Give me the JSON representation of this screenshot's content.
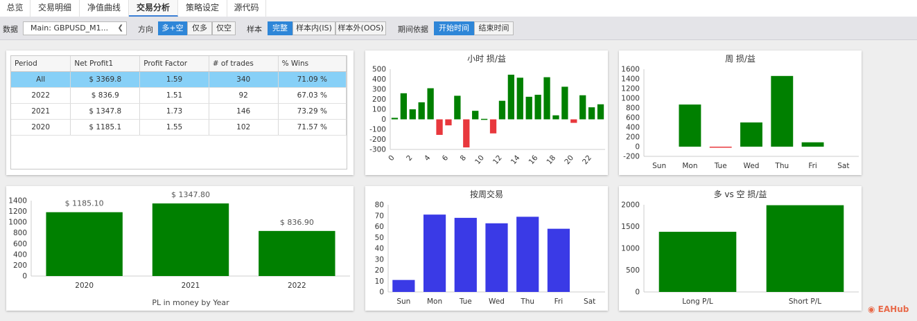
{
  "tabs": [
    "总览",
    "交易明细",
    "净值曲线",
    "交易分析",
    "策略设定",
    "源代码"
  ],
  "active_tab": "交易分析",
  "toolbar": {
    "data_label": "数据",
    "dataset_value": "Main: GBPUSD_M1...",
    "direction_label": "方向",
    "direction_options": [
      "多+空",
      "仅多",
      "仅空"
    ],
    "sample_label": "样本",
    "sample_options": [
      "完整",
      "样本内(IS)",
      "样本外(OOS)"
    ],
    "period_label": "期间依据",
    "period_options": [
      "开始时间",
      "结束时间"
    ]
  },
  "stats_table": {
    "headers": [
      "Period",
      "Net Profit1",
      "Profit Factor",
      "# of trades",
      "% Wins"
    ],
    "rows": [
      [
        "All",
        "$ 3369.8",
        "1.59",
        "340",
        "71.09 %"
      ],
      [
        "2022",
        "$ 836.9",
        "1.51",
        "92",
        "67.03 %"
      ],
      [
        "2021",
        "$ 1347.8",
        "1.73",
        "146",
        "73.29 %"
      ],
      [
        "2020",
        "$ 1185.1",
        "1.55",
        "102",
        "71.57 %"
      ]
    ]
  },
  "watermark": "EAHub",
  "colors": {
    "green": "#008000",
    "red": "#e8383d",
    "blue": "#3a3ae6",
    "accent": "#2e86d8",
    "highlight": "#87d0f7"
  },
  "chart_data": [
    {
      "id": "hourly",
      "type": "bar",
      "title": "小时 损/益",
      "x": [
        0,
        1,
        2,
        3,
        4,
        5,
        6,
        7,
        8,
        9,
        10,
        11,
        12,
        13,
        14,
        15,
        16,
        17,
        18,
        19,
        20,
        21,
        22,
        23
      ],
      "xticks": [
        "0",
        "2",
        "4",
        "6",
        "8",
        "10",
        "12",
        "14",
        "16",
        "18",
        "20",
        "22"
      ],
      "values": [
        15,
        260,
        100,
        170,
        310,
        -155,
        -60,
        235,
        -280,
        85,
        5,
        -140,
        185,
        445,
        415,
        225,
        245,
        420,
        40,
        325,
        -35,
        240,
        120,
        150
      ],
      "ylim": [
        -300,
        500
      ],
      "yticks": [
        "500",
        "400",
        "300",
        "200",
        "100",
        "0",
        "-100",
        "-200",
        "-300"
      ]
    },
    {
      "id": "weekly",
      "type": "bar",
      "title": "周 损/益",
      "categories": [
        "Sun",
        "Mon",
        "Tue",
        "Wed",
        "Thu",
        "Fri",
        "Sat"
      ],
      "values": [
        0,
        870,
        -20,
        500,
        1460,
        90,
        0
      ],
      "ylim": [
        -200,
        1600
      ],
      "yticks": [
        "1600",
        "1400",
        "1200",
        "1000",
        "800",
        "600",
        "400",
        "200",
        "0",
        "-200"
      ]
    },
    {
      "id": "yearly",
      "type": "bar",
      "title": "PL in money by Year",
      "categories": [
        "2020",
        "2021",
        "2022"
      ],
      "values": [
        1185.1,
        1347.8,
        836.9
      ],
      "labels": [
        "$ 1185.10",
        "$ 1347.80",
        "$ 836.90"
      ],
      "ylim": [
        0,
        1400
      ],
      "yticks": [
        "1400",
        "1200",
        "1000",
        "800",
        "600",
        "400",
        "200",
        "0"
      ]
    },
    {
      "id": "trades_by_day",
      "type": "bar",
      "title": "按周交易",
      "categories": [
        "Sun",
        "Mon",
        "Tue",
        "Wed",
        "Thu",
        "Fri",
        "Sat"
      ],
      "values": [
        11,
        71,
        68,
        63,
        69,
        58,
        0
      ],
      "ylim": [
        0,
        80
      ],
      "yticks": [
        "80",
        "70",
        "60",
        "50",
        "40",
        "30",
        "20",
        "10",
        "0"
      ]
    },
    {
      "id": "long_short",
      "type": "bar",
      "title": "多 vs 空 损/益",
      "categories": [
        "Long P/L",
        "Short P/L"
      ],
      "values": [
        1380,
        1990
      ],
      "ylim": [
        0,
        2000
      ],
      "yticks": [
        "2000",
        "1500",
        "1000",
        "500",
        "0"
      ]
    }
  ]
}
